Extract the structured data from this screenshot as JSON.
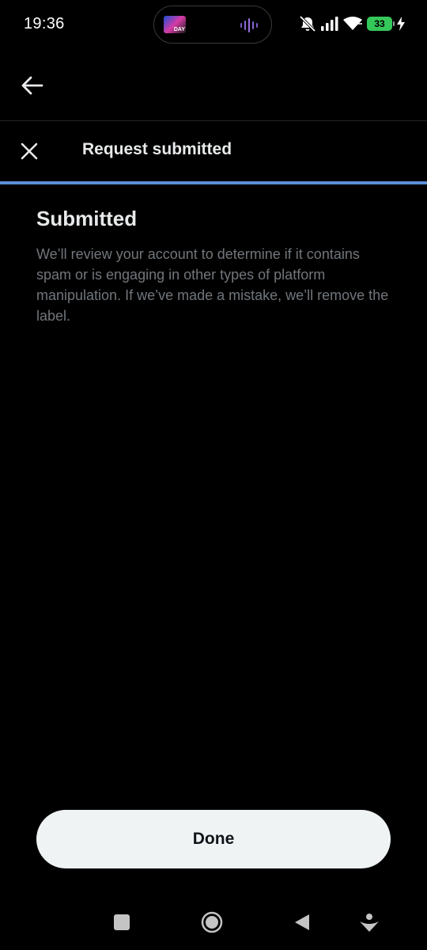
{
  "status_bar": {
    "time": "19:36",
    "island_thumb_label": "DAY",
    "battery_level": "33",
    "icons": [
      "mute-icon",
      "signal-icon",
      "wifi-icon",
      "battery-icon",
      "charging-icon"
    ]
  },
  "nav": {
    "back_icon": "arrow-left-icon"
  },
  "header": {
    "title": "Request submitted",
    "close_icon": "close-icon",
    "progress_fraction": 1.0,
    "accent_color": "#5b8fd9"
  },
  "content": {
    "title": "Submitted",
    "body": "We’ll review your account to determine if it contains spam or is engaging in other types of platform manipulation. If we’ve made a mistake, we’ll remove the label."
  },
  "actions": {
    "done_label": "Done"
  },
  "system_nav": {
    "icons": [
      "recents-square-icon",
      "home-circle-icon",
      "back-triangle-icon",
      "assistant-icon"
    ]
  },
  "colors": {
    "background": "#000000",
    "text_primary": "#e7e9ea",
    "text_secondary": "#71767b",
    "button_bg": "#eff3f4",
    "button_text": "#0f1419",
    "battery": "#34c759"
  }
}
